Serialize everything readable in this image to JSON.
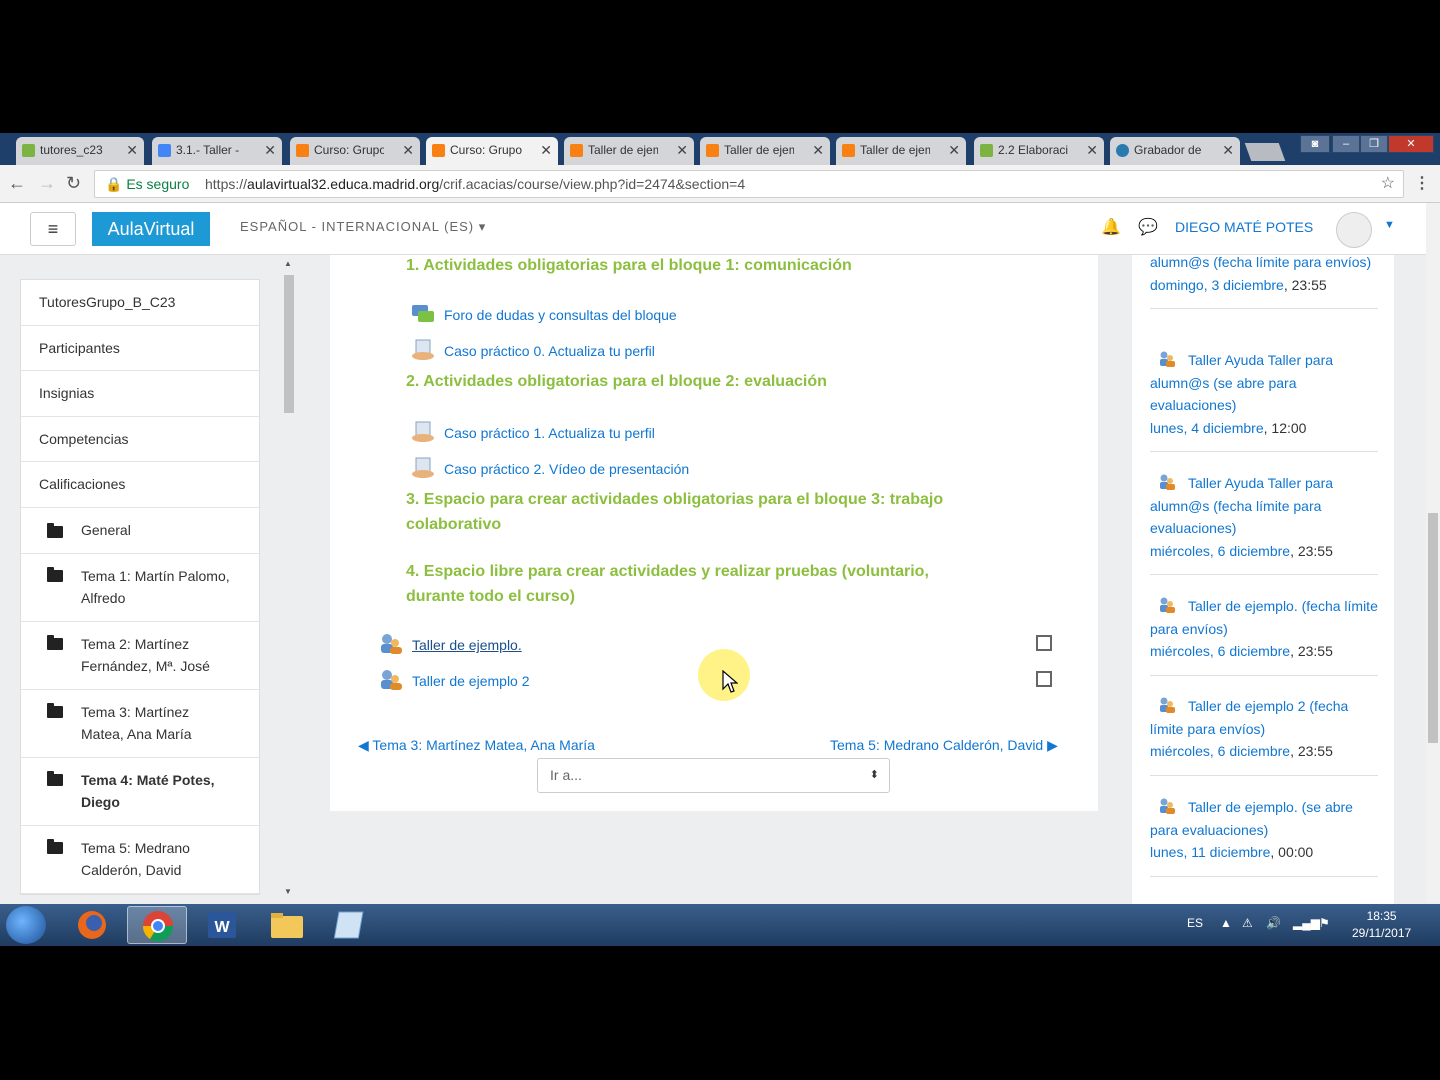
{
  "browser": {
    "tabs": [
      {
        "label": "tutores_c23",
        "icon": "green-leaf-icon"
      },
      {
        "label": "3.1.- Taller -",
        "icon": "docs-icon"
      },
      {
        "label": "Curso: Grupo",
        "icon": "moodle-icon"
      },
      {
        "label": "Curso: Grupo",
        "icon": "moodle-icon",
        "active": true
      },
      {
        "label": "Taller de ejem",
        "icon": "moodle-icon"
      },
      {
        "label": "Taller de ejem",
        "icon": "moodle-icon"
      },
      {
        "label": "Taller de ejem",
        "icon": "moodle-icon"
      },
      {
        "label": "2.2 Elaboraci",
        "icon": "green-leaf-icon"
      },
      {
        "label": "Grabador de",
        "icon": "recorder-icon"
      }
    ],
    "tab_close": "✕",
    "secure_label": "Es seguro",
    "url_prefix": "https://",
    "url_host": "aulavirtual32.educa.madrid.org",
    "url_path": "/crif.acacias/course/view.php?id=2474&section=4"
  },
  "navbar": {
    "menu_glyph": "≡",
    "brand": "AulaVirtual",
    "language": "ESPAÑOL - INTERNACIONAL (ES)",
    "username": "DIEGO MATÉ POTES"
  },
  "leftnav": {
    "items": [
      "TutoresGrupo_B_C23",
      "Participantes",
      "Insignias",
      "Competencias",
      "Calificaciones"
    ],
    "folders": [
      {
        "line1": "General",
        "line2": ""
      },
      {
        "line1": "Tema 1: Martín Palomo,",
        "line2": "Alfredo"
      },
      {
        "line1": "Tema 2: Martínez",
        "line2": "Fernández, Mª. José"
      },
      {
        "line1": "Tema 3: Martínez",
        "line2": "Matea, Ana María"
      },
      {
        "line1": "Tema 4: Maté Potes,",
        "line2": "Diego"
      },
      {
        "line1": "Tema 5: Medrano",
        "line2": "Calderón, David"
      }
    ]
  },
  "main": {
    "section1": "1. Actividades obligatorias para el bloque 1: comunicación",
    "act_foro": "Foro de dudas y consultas del bloque",
    "act_caso0": "Caso práctico 0. Actualiza tu perfil",
    "section2": "2. Actividades obligatorias para el bloque 2: evaluación",
    "act_caso1": "Caso práctico 1. Actualiza tu perfil",
    "act_caso2": "Caso práctico 2. Vídeo de presentación",
    "section3a": "3. Espacio para crear actividades obligatorias para el bloque 3: trabajo",
    "section3b": "colaborativo",
    "section4a": "4. Espacio libre para crear actividades y realizar pruebas (voluntario,",
    "section4b": "durante todo el curso)",
    "taller1": "Taller de ejemplo.",
    "taller2": "Taller de ejemplo 2",
    "prev": "◀ Tema 3: Martínez Matea, Ana María",
    "next": "Tema 5: Medrano Calderón, David ▶",
    "goto": "Ir a..."
  },
  "events": [
    {
      "title": "alumn@s (fecha límite para envíos)",
      "date": "domingo, 3 diciembre",
      "time": "23:55",
      "icon": false
    },
    {
      "title": "Taller Ayuda Taller para alumn@s (se abre para evaluaciones)",
      "date": "lunes, 4 diciembre",
      "time": "12:00",
      "icon": true
    },
    {
      "title": "Taller Ayuda Taller para alumn@s (fecha límite para evaluaciones)",
      "date": "miércoles, 6 diciembre",
      "time": "23:55",
      "icon": true
    },
    {
      "title": "Taller de ejemplo. (fecha límite para envíos)",
      "date": "miércoles, 6 diciembre",
      "time": "23:55",
      "icon": true
    },
    {
      "title": "Taller de ejemplo 2 (fecha límite para envíos)",
      "date": "miércoles, 6 diciembre",
      "time": "23:55",
      "icon": true
    },
    {
      "title": "Taller de ejemplo. (se abre para evaluaciones)",
      "date": "lunes, 11 diciembre",
      "time": "00:00",
      "icon": true
    }
  ],
  "event_date_sep": ", ",
  "taskbar": {
    "lang": "ES",
    "time": "18:35",
    "date": "29/11/2017"
  },
  "colors": {
    "brand": "#1d9ad6",
    "section_green": "#8cbf3f",
    "link_blue": "#1177d1"
  }
}
